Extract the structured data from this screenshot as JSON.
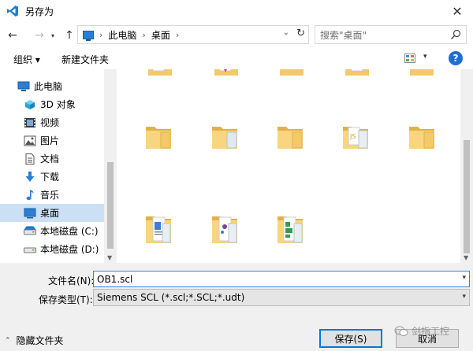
{
  "window": {
    "title": "另存为"
  },
  "address": {
    "crumbs": [
      "此电脑",
      "桌面"
    ]
  },
  "search": {
    "placeholder": "搜索\"桌面\""
  },
  "toolbar": {
    "organize_label": "组织 ▾",
    "new_folder_label": "新建文件夹",
    "help_label": "?"
  },
  "sidebar": {
    "items": [
      {
        "label": "此电脑",
        "icon": "computer-icon"
      },
      {
        "label": "3D 对象",
        "icon": "cube-3d-icon"
      },
      {
        "label": "视频",
        "icon": "video-icon"
      },
      {
        "label": "图片",
        "icon": "pictures-icon"
      },
      {
        "label": "文档",
        "icon": "documents-icon"
      },
      {
        "label": "下载",
        "icon": "download-icon"
      },
      {
        "label": "音乐",
        "icon": "music-icon"
      },
      {
        "label": "桌面",
        "icon": "desktop-icon",
        "selected": true
      },
      {
        "label": "本地磁盘 (C:)",
        "icon": "drive-icon"
      },
      {
        "label": "本地磁盘 (D:)",
        "icon": "drive-icon"
      }
    ]
  },
  "form": {
    "filename_label": "文件名(N):",
    "filename_value": "OB1.scl",
    "filetype_label": "保存类型(T):",
    "filetype_value": "Siemens SCL (*.scl;*.SCL;*.udt)"
  },
  "footer": {
    "hide_folders_label": "隐藏文件夹",
    "save_label": "保存(S)",
    "cancel_label": "取消"
  },
  "watermark": {
    "text": "剑指工控"
  },
  "colors": {
    "accent": "#0078d7",
    "folder": "#f4c96a",
    "selected": "#cce0f5"
  }
}
